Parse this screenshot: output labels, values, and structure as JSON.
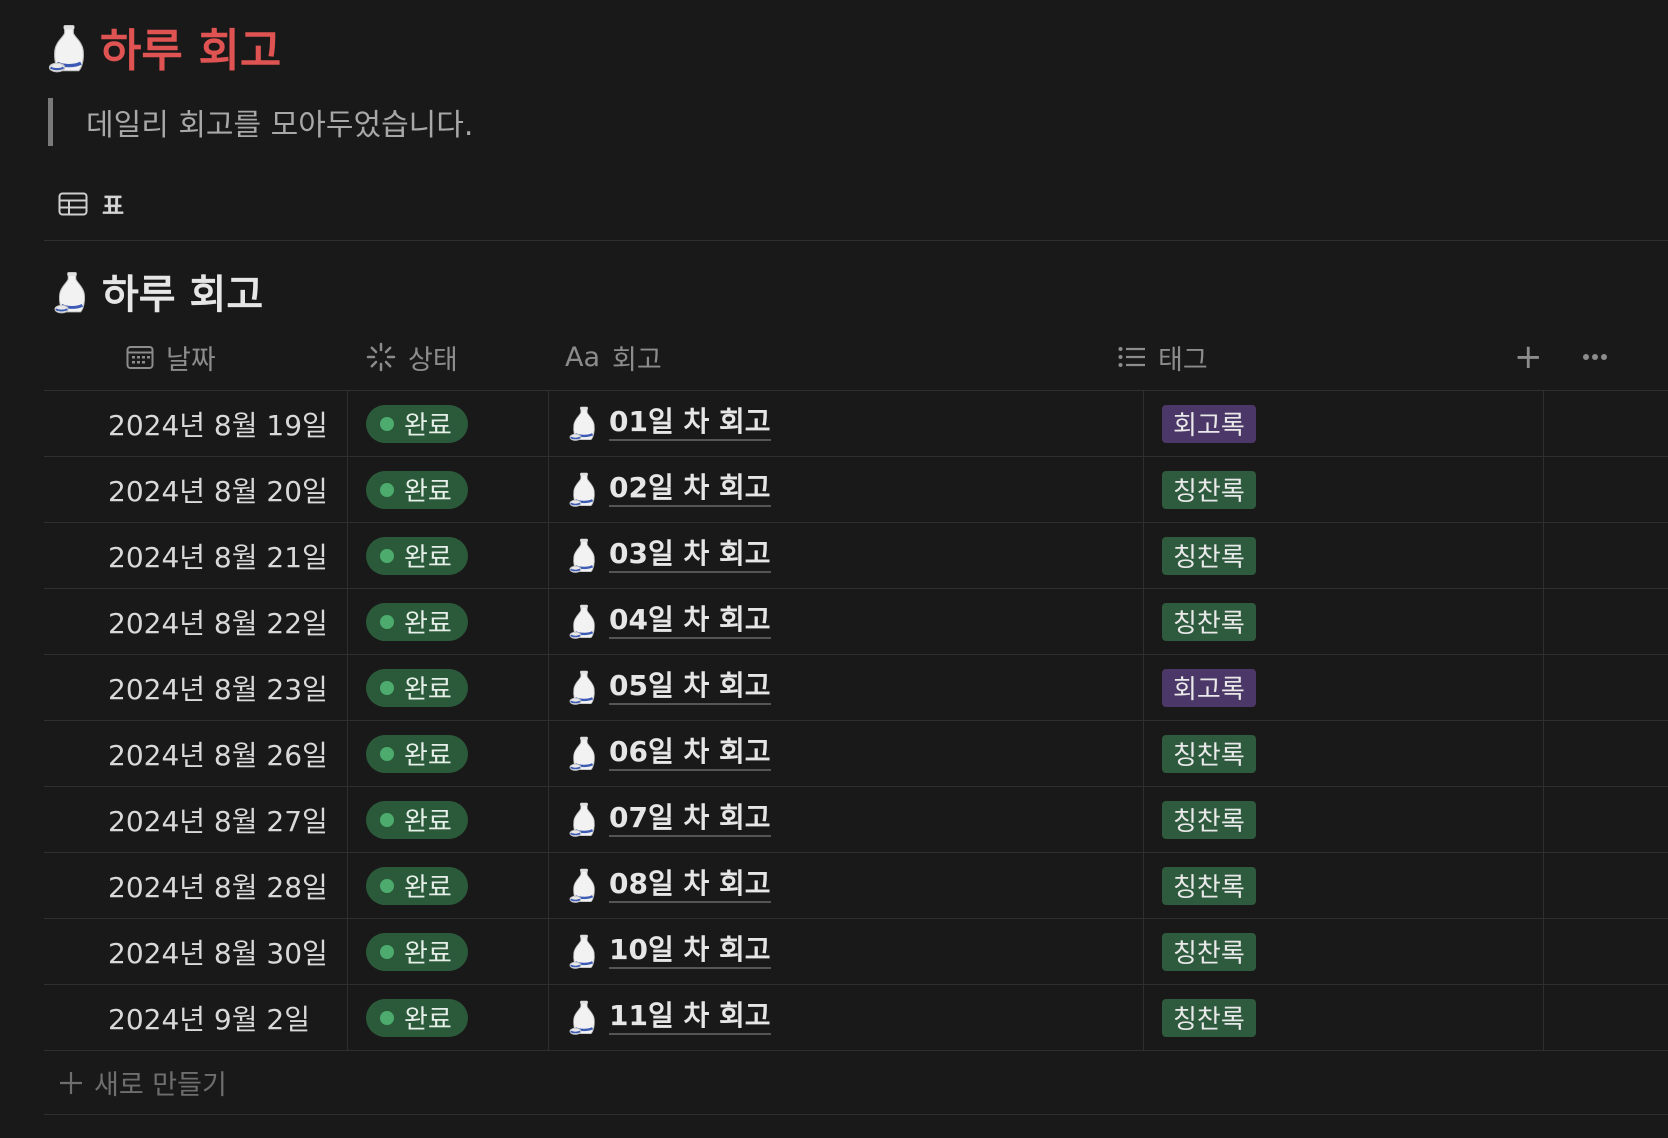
{
  "page": {
    "title": "하루 회고",
    "description": "데일리 회고를 모아두었습니다.",
    "title_color": "#df5452"
  },
  "view": {
    "tab_label": "표",
    "tab_icon": "table-icon"
  },
  "database": {
    "title": "하루 회고",
    "icon": "sake-bottle-icon",
    "columns": {
      "date": {
        "label": "날짜",
        "icon": "calendar-icon"
      },
      "status": {
        "label": "상태",
        "icon": "status-spinner-icon"
      },
      "title": {
        "label": "회고",
        "icon_text": "Aa"
      },
      "tag": {
        "label": "태그",
        "icon": "list-icon"
      }
    },
    "add_column": "+",
    "more": "more-icon",
    "rows": [
      {
        "date": "2024년 8월 19일",
        "status": "완료",
        "title": "01일 차 회고",
        "tag": "회고록",
        "tag_color": "#4b3768"
      },
      {
        "date": "2024년 8월 20일",
        "status": "완료",
        "title": "02일 차 회고",
        "tag": "칭찬록",
        "tag_color": "#2e5a3e"
      },
      {
        "date": "2024년 8월 21일",
        "status": "완료",
        "title": "03일 차 회고",
        "tag": "칭찬록",
        "tag_color": "#2e5a3e"
      },
      {
        "date": "2024년 8월 22일",
        "status": "완료",
        "title": "04일 차 회고",
        "tag": "칭찬록",
        "tag_color": "#2e5a3e"
      },
      {
        "date": "2024년 8월 23일",
        "status": "완료",
        "title": "05일 차 회고",
        "tag": "회고록",
        "tag_color": "#4b3768"
      },
      {
        "date": "2024년 8월 26일",
        "status": "완료",
        "title": "06일 차 회고",
        "tag": "칭찬록",
        "tag_color": "#2e5a3e"
      },
      {
        "date": "2024년 8월 27일",
        "status": "완료",
        "title": "07일 차 회고",
        "tag": "칭찬록",
        "tag_color": "#2e5a3e"
      },
      {
        "date": "2024년 8월 28일",
        "status": "완료",
        "title": "08일 차 회고",
        "tag": "칭찬록",
        "tag_color": "#2e5a3e"
      },
      {
        "date": "2024년 8월 30일",
        "status": "완료",
        "title": "10일 차 회고",
        "tag": "칭찬록",
        "tag_color": "#2e5a3e"
      },
      {
        "date": "2024년 9월 2일",
        "status": "완료",
        "title": "11일 차 회고",
        "tag": "칭찬록",
        "tag_color": "#2e5a3e"
      }
    ],
    "new_row_label": "새로 만들기"
  }
}
